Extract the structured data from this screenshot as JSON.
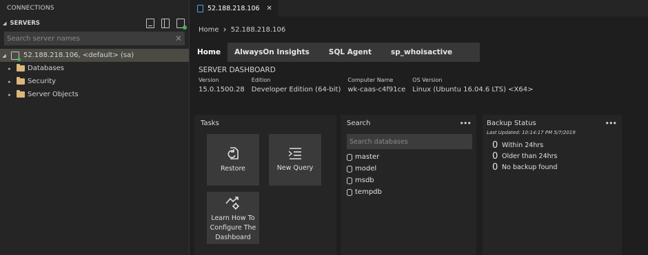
{
  "sidebar": {
    "header": "CONNECTIONS",
    "section": "SERVERS",
    "search_placeholder": "Search server names",
    "server": {
      "name": "52.188.218.106",
      "detail": ", <default> (sa)"
    },
    "folders": [
      "Databases",
      "Security",
      "Server Objects"
    ]
  },
  "tab": {
    "title": "52.188.218.106",
    "close": "✕"
  },
  "breadcrumb": {
    "home": "Home",
    "current": "52.188.218.106"
  },
  "dashboard_tabs": [
    "Home",
    "AlwaysOn Insights",
    "SQL Agent",
    "sp_whoisactive"
  ],
  "server_dashboard": {
    "title": "SERVER DASHBOARD",
    "props": [
      {
        "label": "Version",
        "value": "15.0.1500.28"
      },
      {
        "label": "Edition",
        "value": "Developer Edition (64-bit)"
      },
      {
        "label": "Computer Name",
        "value": "wk-caas-c4f91ce"
      },
      {
        "label": "OS Version",
        "value": "Linux (Ubuntu 16.04.6 LTS) <X64>"
      }
    ]
  },
  "tasks": {
    "title": "Tasks",
    "items": [
      {
        "label": "Restore",
        "icon": "restore-icon"
      },
      {
        "label": "New Query",
        "icon": "new-query-icon"
      },
      {
        "label": "Learn How To Configure The Dashboard",
        "icon": "learn-configure-icon"
      }
    ]
  },
  "search_widget": {
    "title": "Search",
    "placeholder": "Search databases",
    "databases": [
      "master",
      "model",
      "msdb",
      "tempdb"
    ]
  },
  "backup_widget": {
    "title": "Backup Status",
    "last_updated": "Last Updated: 10:14:17 PM 5/7/2019",
    "rows": [
      {
        "count": "0",
        "label": "Within 24hrs"
      },
      {
        "count": "0",
        "label": "Older than 24hrs"
      },
      {
        "count": "0",
        "label": "No backup found"
      }
    ]
  },
  "more_label": "•••",
  "colors": {
    "background": "#1e1e1e",
    "sidebar": "#252526",
    "selection": "#4b4b44",
    "folder": "#dcb67a",
    "connected": "#3fb950",
    "tile": "#3a3a3a"
  }
}
